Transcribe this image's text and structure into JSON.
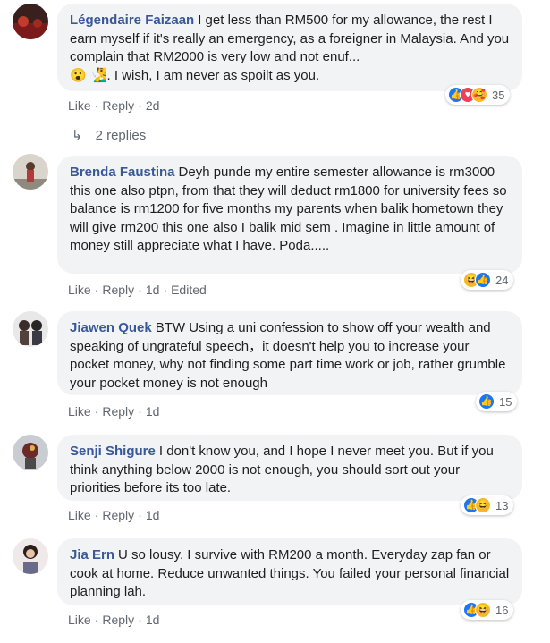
{
  "comments": [
    {
      "author": "Légendaire Faizaan",
      "text": "I get less than RM500 for my allowance, the rest I earn myself if it's really an emergency, as a foreigner in Malaysia. And you complain that RM2000 is very low and not enuf...",
      "text_tail": ". I wish, I am never as spoilt as you.",
      "emojis": [
        "😮",
        "🧏‍♂️"
      ],
      "reactions": [
        "like-icon",
        "love-icon",
        "care-icon"
      ],
      "reaction_count": "35",
      "like_label": "Like",
      "reply_label": "Reply",
      "time": "2d",
      "replies_label": "2 replies"
    },
    {
      "author": "Brenda Faustina",
      "text": "Deyh punde my entire semester allowance is rm3000 this one also ptpn, from that they will deduct rm1800 for university fees so balance is rm1200 for five months my parents when balik hometown they will give rm200 this one also I balik mid sem . Imagine in little amount of money still appreciate what I have. Poda.....",
      "reactions": [
        "haha-icon",
        "like-icon"
      ],
      "reaction_count": "24",
      "like_label": "Like",
      "reply_label": "Reply",
      "time": "1d",
      "edited_label": "Edited"
    },
    {
      "author": "Jiawen Quek",
      "text": "BTW Using a uni confession to show off your wealth and speaking of ungrateful speech，it doesn't help you to increase your pocket money, why not finding some part time work or job, rather grumble your pocket money is not enough",
      "reactions": [
        "like-icon"
      ],
      "reaction_count": "15",
      "like_label": "Like",
      "reply_label": "Reply",
      "time": "1d"
    },
    {
      "author": "Senji Shigure",
      "text": "I don't know you, and I hope I never meet you. But if you think anything below 2000 is not enough, you should sort out your priorities before its too late.",
      "reactions": [
        "like-icon",
        "haha-icon"
      ],
      "reaction_count": "13",
      "like_label": "Like",
      "reply_label": "Reply",
      "time": "1d"
    },
    {
      "author": "Jia Ern",
      "text": "U so lousy. I survive with RM200 a month. Everyday zap fan or cook at home. Reduce unwanted things. You failed your personal financial planning lah.",
      "reactions": [
        "like-icon",
        "haha-icon"
      ],
      "reaction_count": "16",
      "like_label": "Like",
      "reply_label": "Reply",
      "time": "1d"
    }
  ],
  "colors": {
    "author": "#385898",
    "bubble": "#f2f3f5",
    "meta": "#606770",
    "like": "#1877f2",
    "love": "#f33e58",
    "haha": "#f7b928"
  }
}
